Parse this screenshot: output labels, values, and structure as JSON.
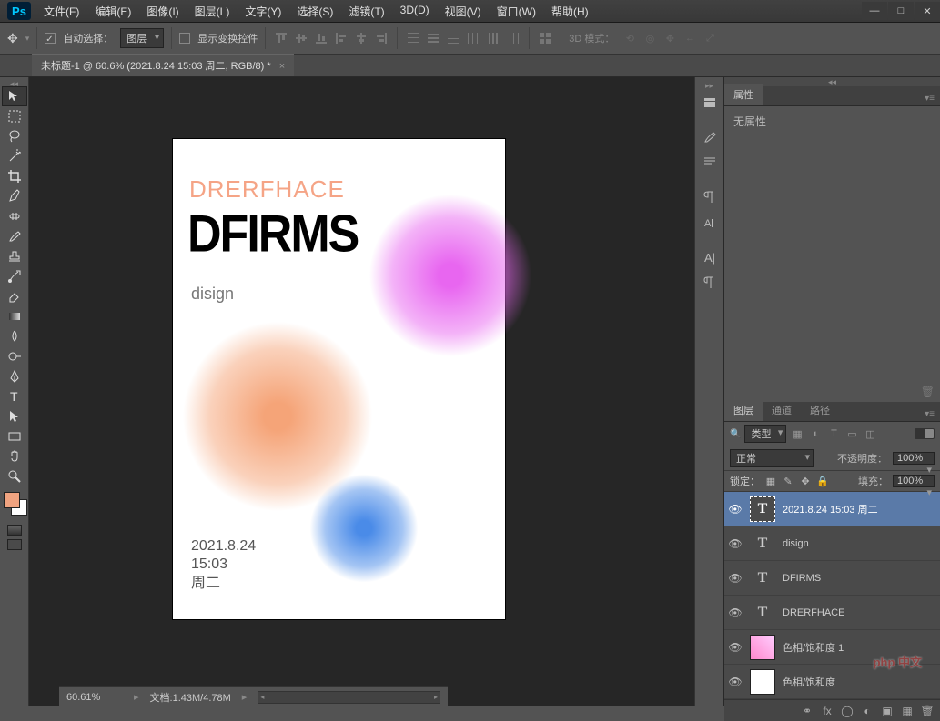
{
  "menu": {
    "file": "文件(F)",
    "edit": "编辑(E)",
    "image": "图像(I)",
    "layer": "图层(L)",
    "type": "文字(Y)",
    "select": "选择(S)",
    "filter": "滤镜(T)",
    "threeD": "3D(D)",
    "view": "视图(V)",
    "window": "窗口(W)",
    "help": "帮助(H)"
  },
  "options": {
    "autoSelect": "自动选择：",
    "layerDD": "图层",
    "showTransform": "显示变换控件",
    "threeDMode": "3D 模式："
  },
  "docTab": {
    "title": "未标题-1 @ 60.6% (2021.8.24 15:03 周二, RGB/8) *"
  },
  "canvasText": {
    "drer": "DRERFHACE",
    "dfirms": "DFIRMS",
    "disign": "disign",
    "date": "2021.8.24",
    "time": "15:03",
    "weekday": "周二"
  },
  "propsPanel": {
    "tab": "属性",
    "noProps": "无属性"
  },
  "layersPanel": {
    "tabs": {
      "layers": "图层",
      "channels": "通道",
      "paths": "路径"
    },
    "filterKind": "类型",
    "blendMode": "正常",
    "opacityLabel": "不透明度：",
    "opacityVal": "100%",
    "lockLabel": "锁定：",
    "fillLabel": "填充：",
    "fillVal": "100%",
    "layers": [
      {
        "name": "2021.8.24  15:03 周二",
        "type": "T",
        "selected": true
      },
      {
        "name": "disign",
        "type": "T"
      },
      {
        "name": "DFIRMS",
        "type": "T"
      },
      {
        "name": "DRERFHACE",
        "type": "T"
      },
      {
        "name": "色相/饱和度  1",
        "type": "adj"
      },
      {
        "name": "色相/饱和度",
        "type": "adj2"
      }
    ],
    "searchIcon": "🔍"
  },
  "status": {
    "zoom": "60.61%",
    "docInfo": "文档:1.43M/4.78M"
  },
  "watermark": "php 中文"
}
